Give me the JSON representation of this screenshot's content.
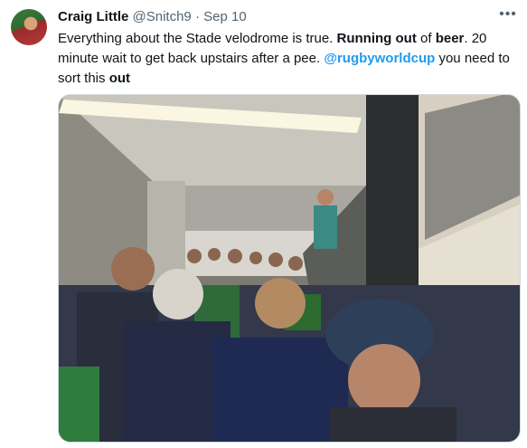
{
  "tweet": {
    "author_name": "Craig Little",
    "author_handle": "@Snitch9",
    "separator": "·",
    "date": "Sep 10",
    "more_icon": "more-horizontal-icon",
    "text_segments": [
      {
        "t": "Everything about the Stade velodrome is true. "
      },
      {
        "t": "Running out",
        "b": true
      },
      {
        "t": " of "
      },
      {
        "t": "beer",
        "b": true
      },
      {
        "t": ". 20 minute wait to get back upstairs after a pee. "
      },
      {
        "t": "@rugbyworldcup",
        "mention": true
      },
      {
        "t": " you need to sort this "
      },
      {
        "t": "out",
        "b": true
      }
    ],
    "mention_color": "#1d9bf0"
  }
}
